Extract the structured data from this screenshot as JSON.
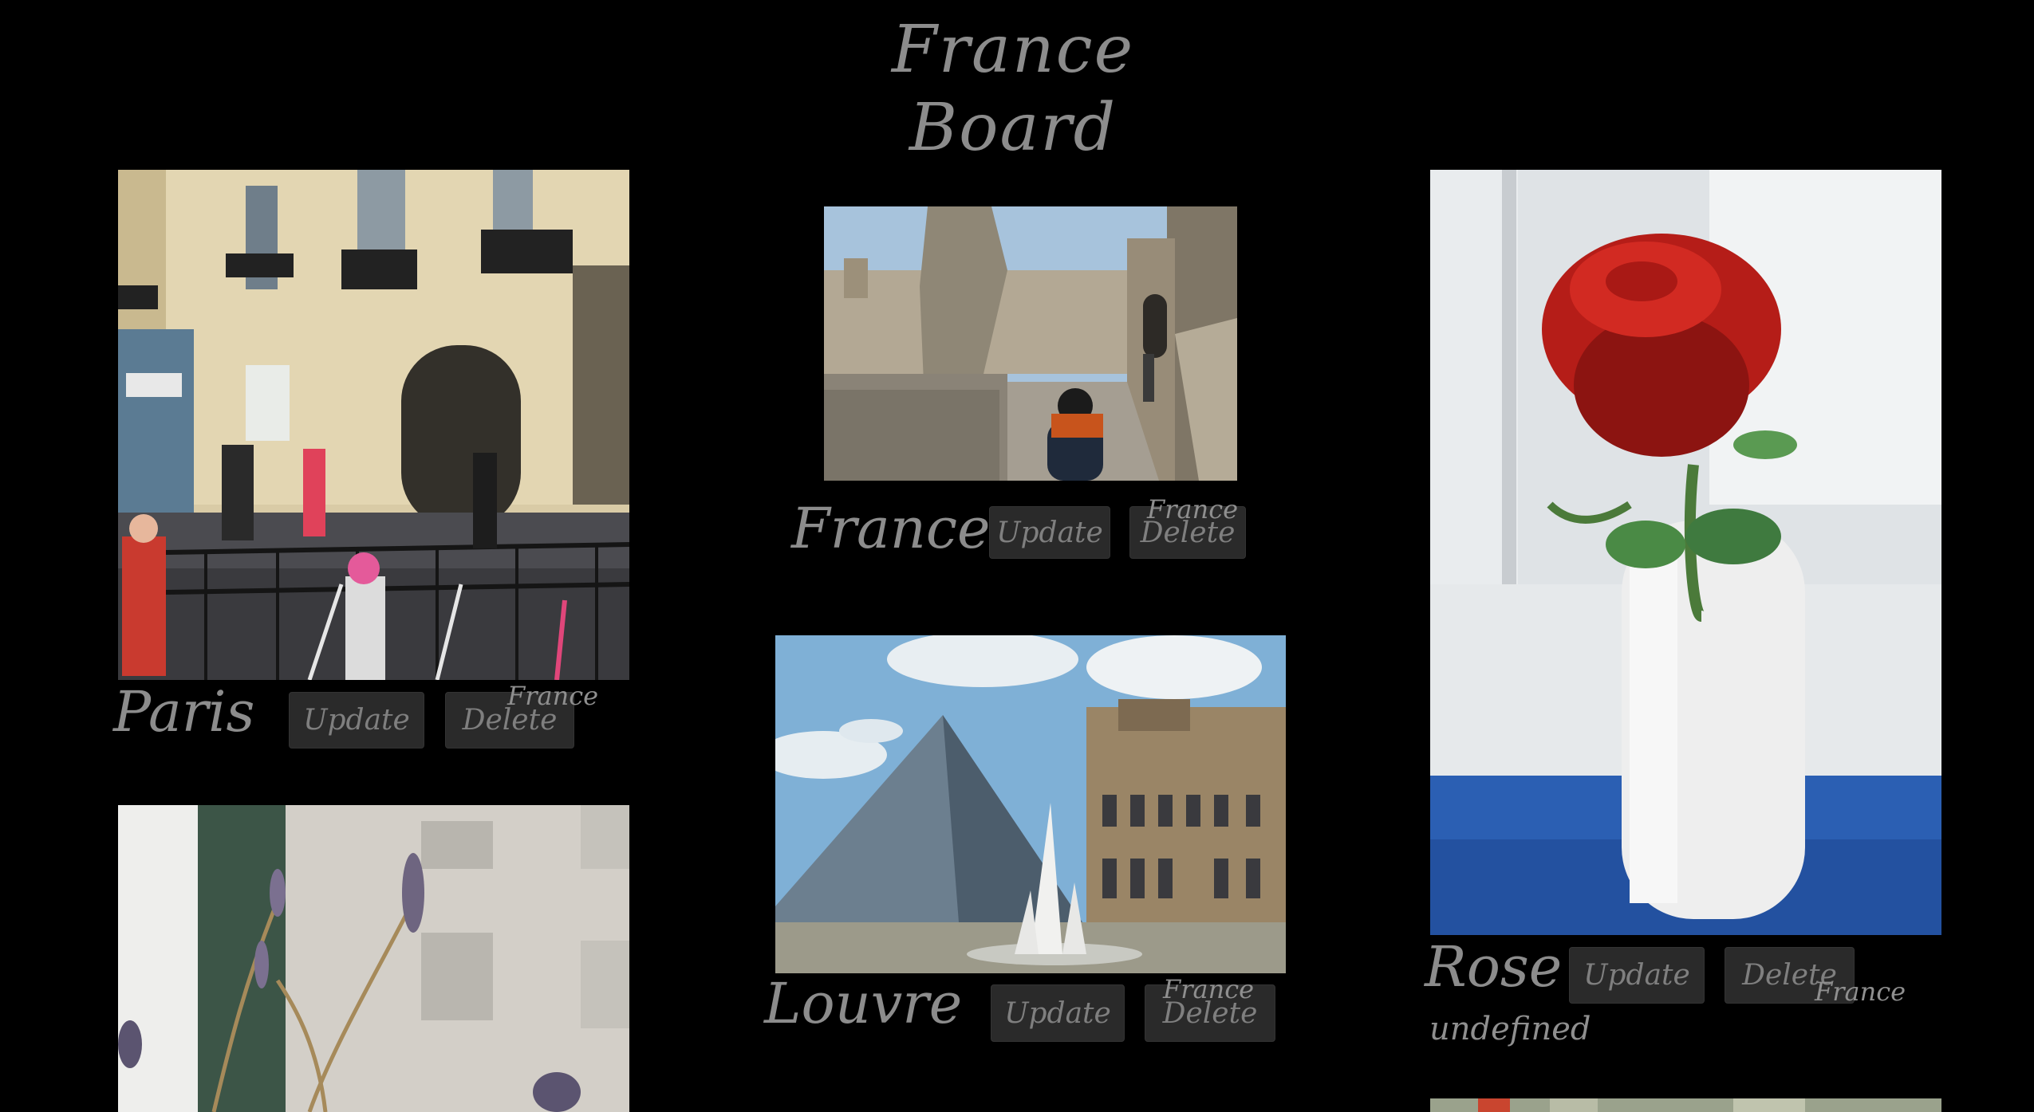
{
  "page": {
    "title": "France Board"
  },
  "cards": [
    {
      "caption": "Paris",
      "update_label": "Update",
      "delete_label": "Delete",
      "tag": "France",
      "image": "paris-street-photo"
    },
    {
      "caption": "France",
      "update_label": "Update",
      "delete_label": "Delete",
      "tag": "France",
      "image": "medieval-walkway-photo"
    },
    {
      "caption": "Louvre",
      "update_label": "Update",
      "delete_label": "Delete",
      "tag": "France",
      "image": "louvre-pyramid-photo"
    },
    {
      "caption": "Rose",
      "update_label": "Update",
      "delete_label": "Delete",
      "tag": "France",
      "extra_text": "undefined",
      "image": "red-rose-vase-photo"
    },
    {
      "image": "lavender-window-photo"
    },
    {
      "image": "flowers-photo"
    }
  ],
  "colors": {
    "background": "#000000",
    "button": "#2a2a2a",
    "text": "#8c8c8c"
  }
}
